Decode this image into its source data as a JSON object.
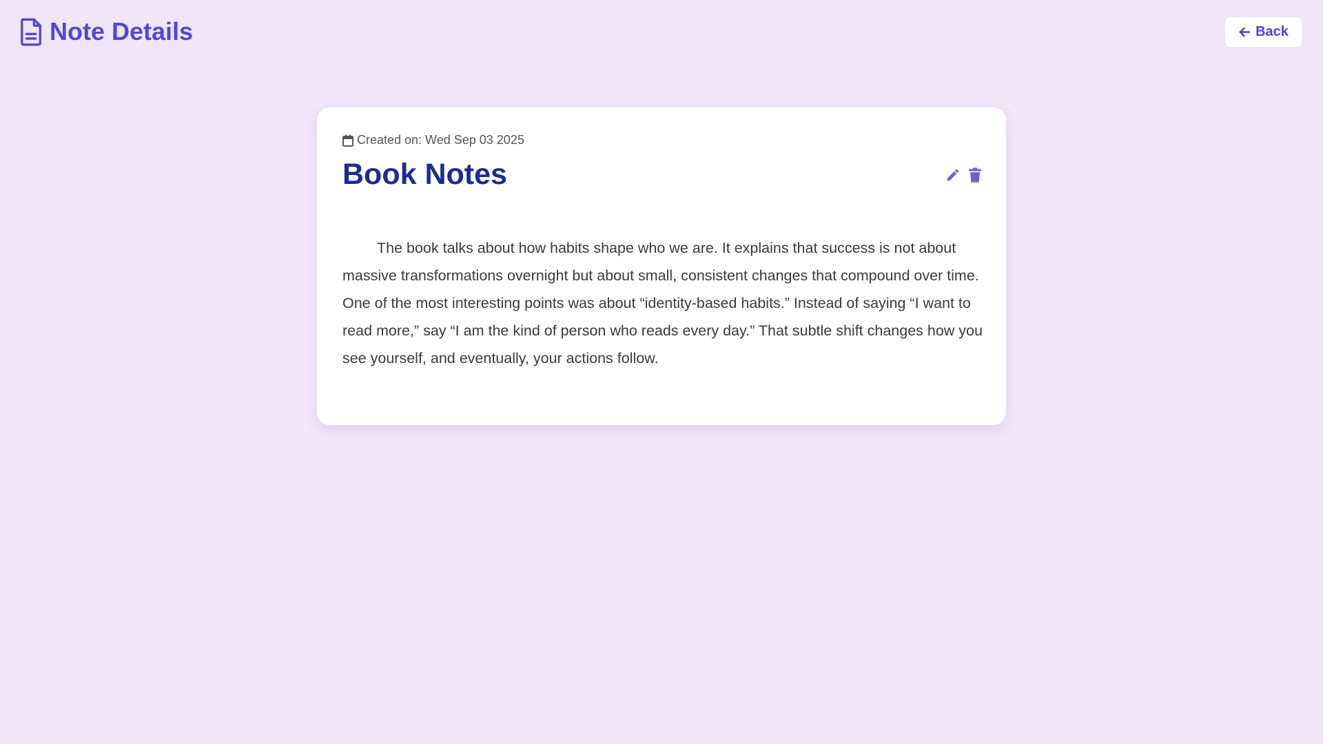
{
  "header": {
    "title": "Note Details",
    "icon": "document-icon",
    "back_label": "Back",
    "back_icon": "arrow-left-icon"
  },
  "note": {
    "created_label": "Created on: Wed Sep 03 2025",
    "title": "Book Notes",
    "body": "The book talks about how habits shape who we are. It explains that success is not about massive transformations overnight but about small, consistent changes that compound over time. One of the most interesting points was about “identity-based habits.” Instead of saying “I want to read more,” say “I am the kind of person who reads every day.” That subtle shift changes how you see yourself, and eventually, your actions follow.",
    "actions": [
      "edit-icon",
      "trash-icon"
    ]
  },
  "colors": {
    "background": "#f1e5f8",
    "accent": "#5147d9",
    "title": "#1b2c92",
    "action_icons": "#6b63c9"
  }
}
